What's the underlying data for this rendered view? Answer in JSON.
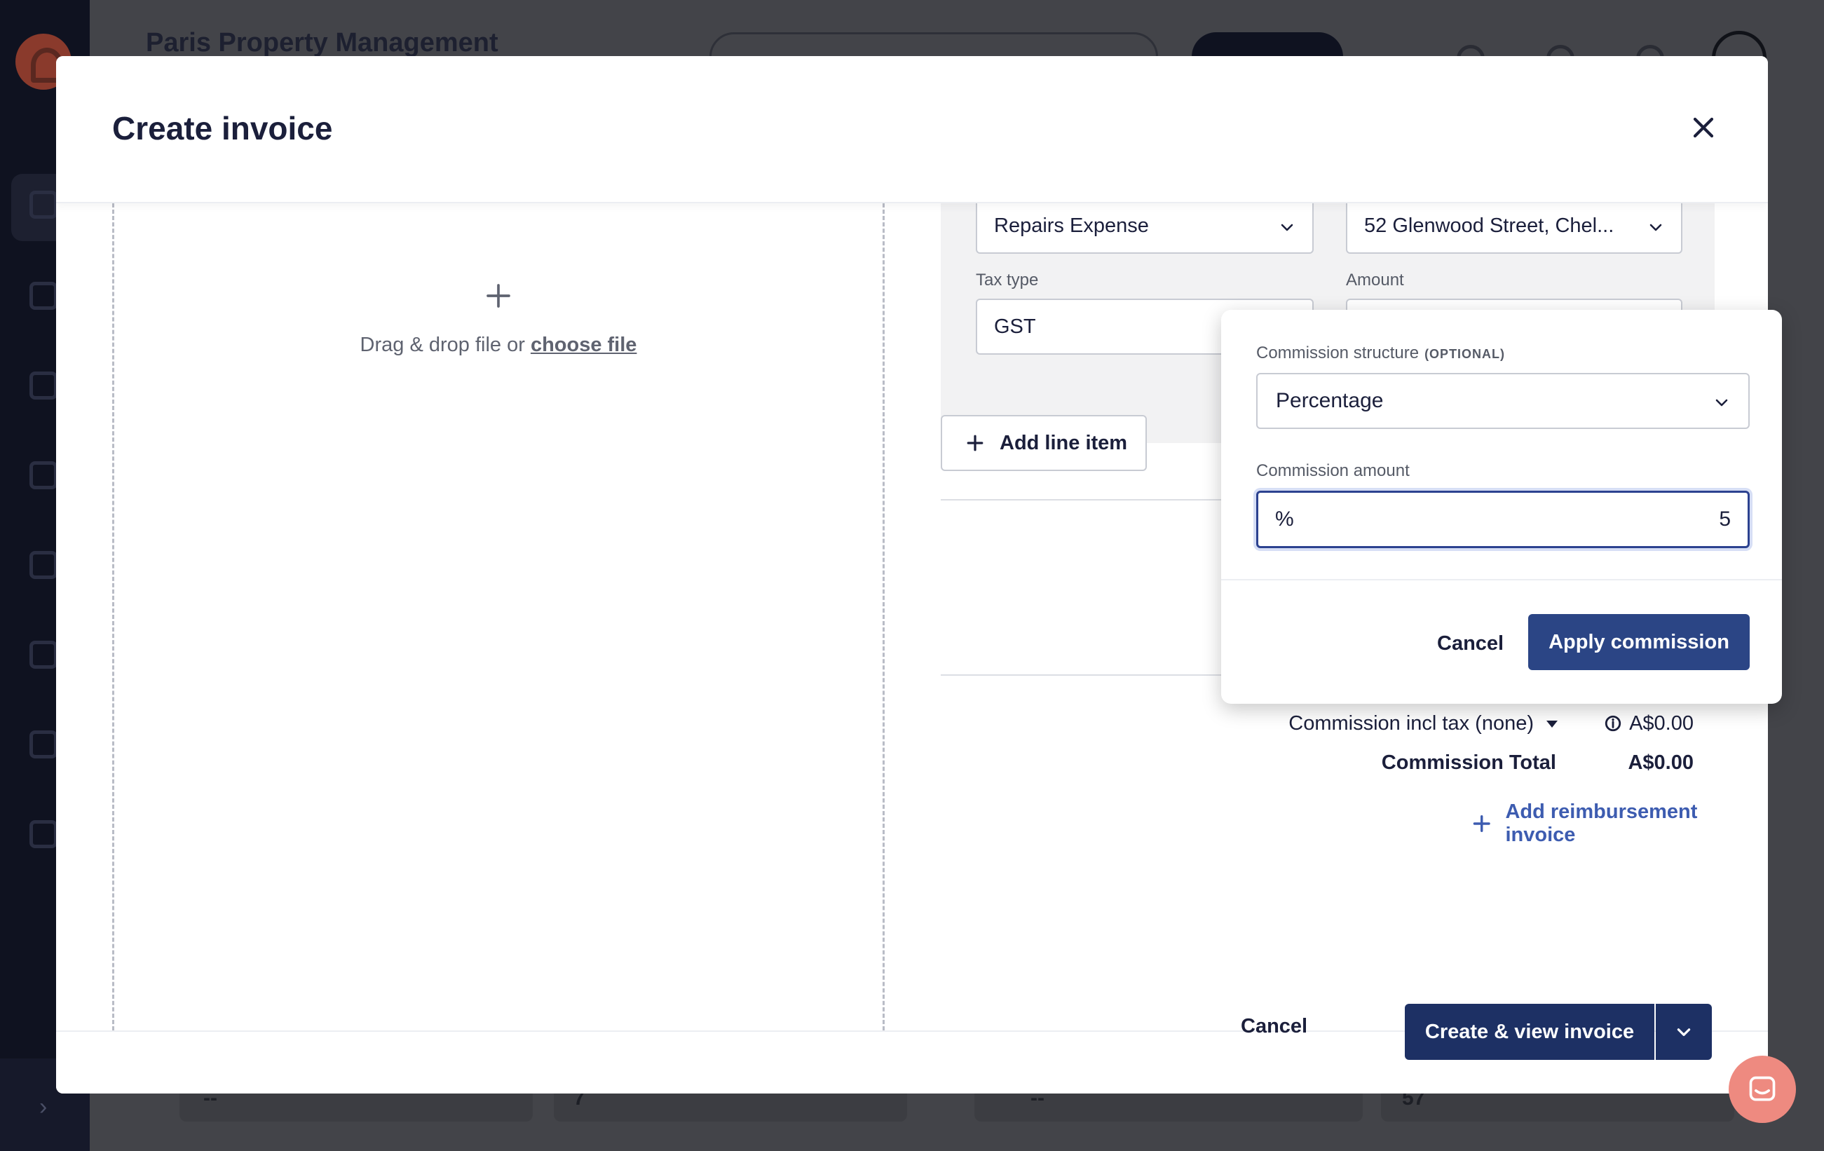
{
  "app": {
    "org_name": "Paris Property Management",
    "bg_cards": [
      "--",
      "7",
      "--",
      "57"
    ]
  },
  "modal": {
    "title": "Create invoice"
  },
  "upload": {
    "text": "Drag & drop file or",
    "link": "choose file"
  },
  "line_item": {
    "account_value": "Repairs Expense",
    "property_value": "52 Glenwood Street, Chel...",
    "tax_type_label": "Tax type",
    "tax_type_value": "GST",
    "amount_label": "Amount",
    "add_line_label": "Add line item"
  },
  "summary": {
    "commission_label": "Commission incl tax (none)",
    "commission_value": "A$0.00",
    "total_label": "Commission Total",
    "total_value": "A$0.00",
    "reimbursement_label": "Add reimbursement invoice"
  },
  "popover": {
    "structure_label": "Commission structure",
    "optional_tag": "(OPTIONAL)",
    "structure_value": "Percentage",
    "amount_label": "Commission amount",
    "amount_prefix": "%",
    "amount_value": "5",
    "cancel_label": "Cancel",
    "apply_label": "Apply commission"
  },
  "footer": {
    "cancel_label": "Cancel",
    "primary_label": "Create & view invoice"
  },
  "colors": {
    "primary": "#1d3064",
    "link": "#3d5cb0",
    "chat": "#ee8a80"
  }
}
